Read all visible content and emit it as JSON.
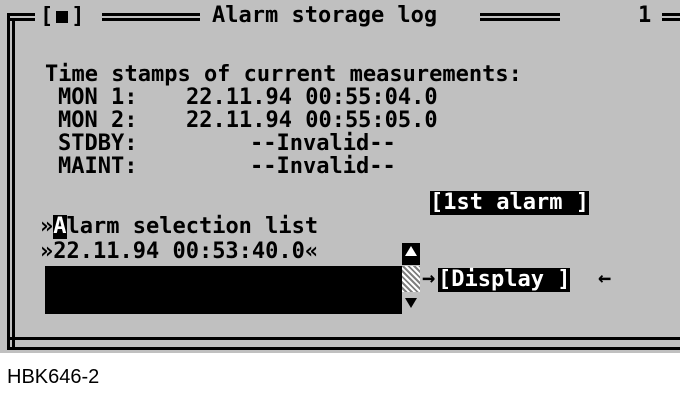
{
  "window": {
    "title": "Alarm storage log",
    "page_number": "1",
    "close_glyph": "[■]"
  },
  "section_heading": "Time stamps of current measurements:",
  "timestamps": [
    {
      "label": "MON 1:",
      "value": "22.11.94 00:55:04.0"
    },
    {
      "label": "MON 2:",
      "value": "22.11.94 00:55:05.0"
    },
    {
      "label": "STDBY:",
      "value": "--Invalid--"
    },
    {
      "label": "MAINT:",
      "value": "--Invalid--"
    }
  ],
  "buttons": {
    "first_alarm": "[1st alarm ]",
    "display": "[Display ]"
  },
  "alarm_list": {
    "prefix": "»",
    "hotkey": "A",
    "title_rest": "larm selection list",
    "selected_prefix": "»",
    "selected_entry": "22.11.94 00:53:40.0",
    "selected_suffix": "«"
  },
  "arrows": {
    "right": "→",
    "left": "←"
  },
  "caption": "HBK646-2"
}
